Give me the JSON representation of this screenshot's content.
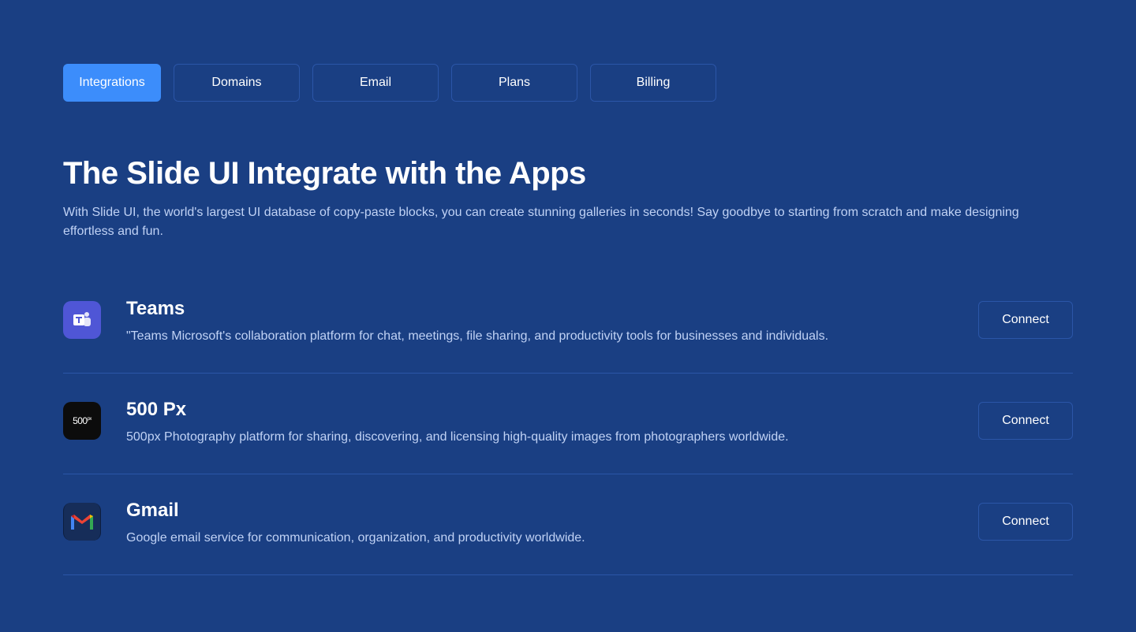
{
  "tabs": [
    {
      "label": "Integrations",
      "active": true
    },
    {
      "label": "Domains",
      "active": false
    },
    {
      "label": "Email",
      "active": false
    },
    {
      "label": "Plans",
      "active": false
    },
    {
      "label": "Billing",
      "active": false
    }
  ],
  "heading": {
    "title": "The Slide UI Integrate with the Apps",
    "subtitle": "With Slide UI, the world's largest UI database of copy-paste blocks, you can create stunning galleries in seconds! Say goodbye to starting from scratch and make designing effortless and fun."
  },
  "integrations": [
    {
      "name": "Teams",
      "description": "\"Teams Microsoft's collaboration platform for chat, meetings, file sharing, and productivity tools for businesses and individuals.",
      "icon": "teams-icon",
      "button": "Connect"
    },
    {
      "name": "500 Px",
      "description": "500px Photography platform for sharing, discovering, and licensing high-quality images from photographers worldwide.",
      "icon": "500px-icon",
      "logo_text": "500",
      "logo_sup": "px",
      "button": "Connect"
    },
    {
      "name": "Gmail",
      "description": "Google email service for communication, organization, and productivity worldwide.",
      "icon": "gmail-icon",
      "button": "Connect"
    }
  ],
  "colors": {
    "background": "#1a3f83",
    "accent": "#3c8dfb",
    "border": "#2b56a8",
    "muted_text": "#c0d2f5"
  }
}
